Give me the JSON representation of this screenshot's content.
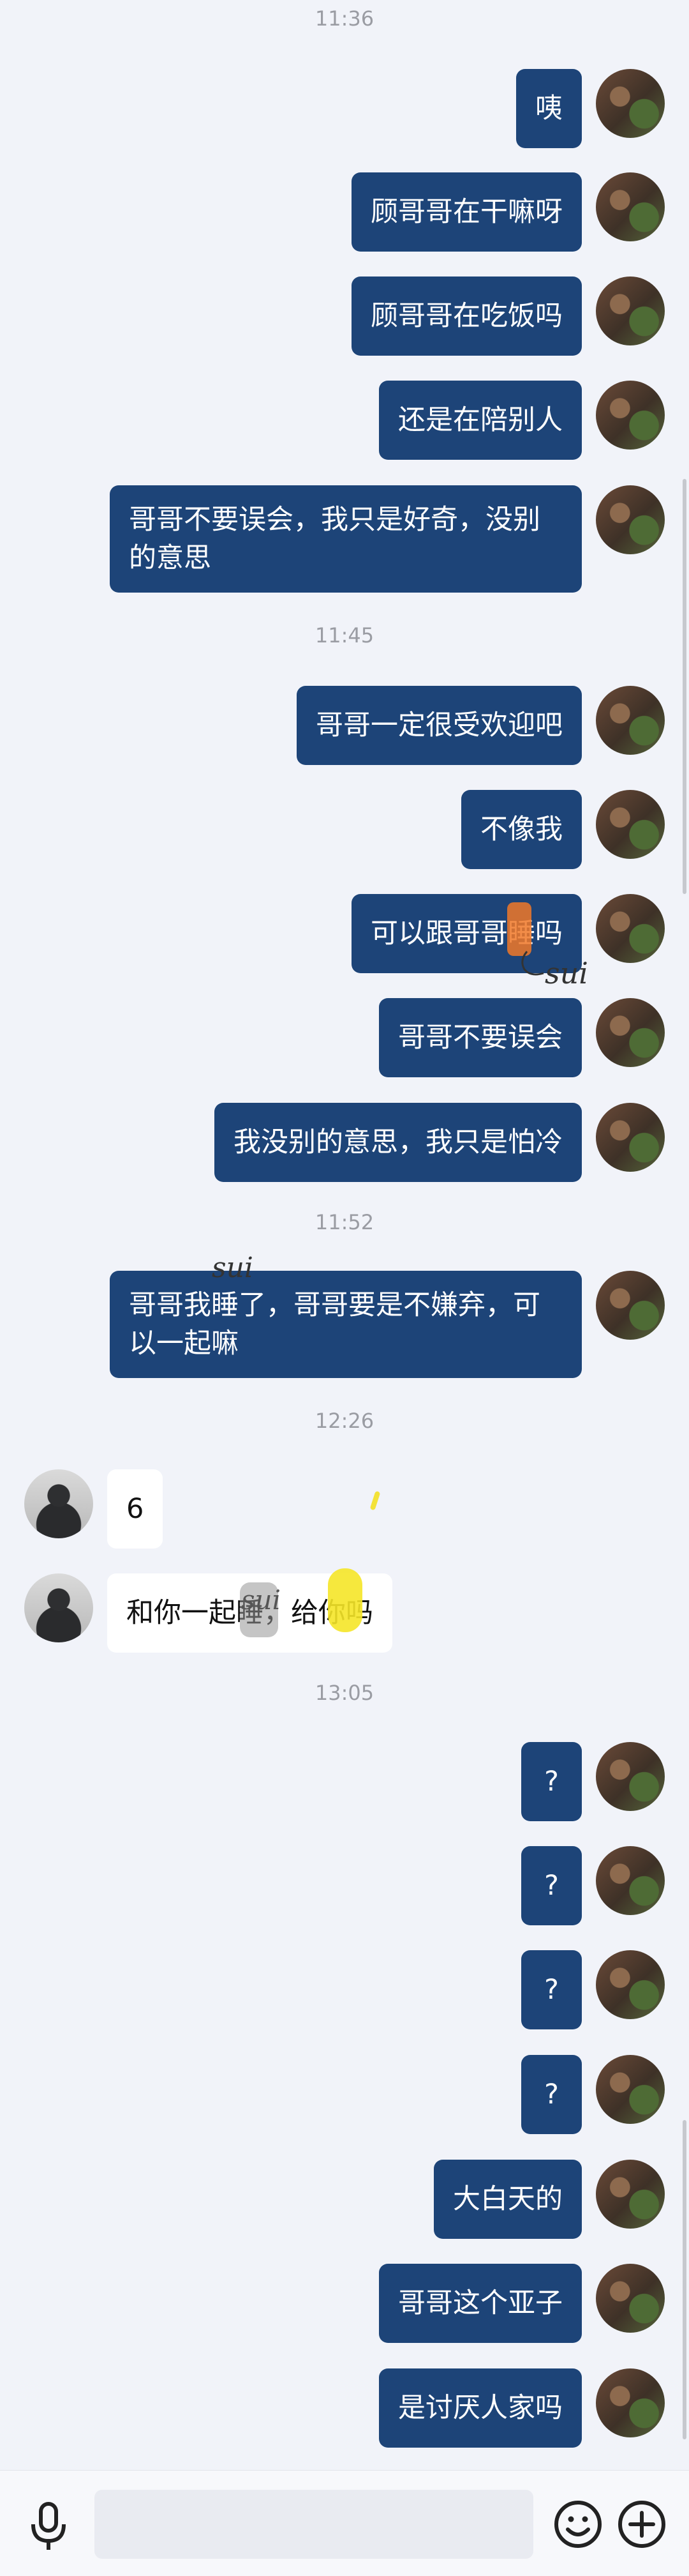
{
  "messages": [
    {
      "type": "timestamp",
      "text": "11:36"
    },
    {
      "type": "out",
      "text": "咦"
    },
    {
      "type": "out",
      "text": "顾哥哥在干嘛呀"
    },
    {
      "type": "out",
      "text": "顾哥哥在吃饭吗"
    },
    {
      "type": "out",
      "text": "还是在陪别人"
    },
    {
      "type": "out",
      "text": "哥哥不要误会，我只是好奇，没别的意思"
    },
    {
      "type": "timestamp",
      "text": "11:45"
    },
    {
      "type": "out",
      "text": "哥哥一定很受欢迎吧"
    },
    {
      "type": "out",
      "text": "不像我"
    },
    {
      "type": "out",
      "text": "可以跟哥哥睡吗"
    },
    {
      "type": "out",
      "text": "哥哥不要误会"
    },
    {
      "type": "out",
      "text": "我没别的意思，我只是怕冷"
    },
    {
      "type": "timestamp",
      "text": "11:52"
    },
    {
      "type": "out",
      "text": "哥哥我睡了，哥哥要是不嫌弃，可以一起嘛"
    },
    {
      "type": "timestamp",
      "text": "12:26"
    },
    {
      "type": "in",
      "text": "6"
    },
    {
      "type": "in",
      "text": "和你一起睡，给你吗"
    },
    {
      "type": "timestamp",
      "text": "13:05"
    },
    {
      "type": "out",
      "text": "?"
    },
    {
      "type": "out",
      "text": "?"
    },
    {
      "type": "out",
      "text": "?"
    },
    {
      "type": "out",
      "text": "?"
    },
    {
      "type": "out",
      "text": "大白天的"
    },
    {
      "type": "out",
      "text": "哥哥这个亚子"
    },
    {
      "type": "out",
      "text": "是讨厌人家吗"
    }
  ],
  "annotations": {
    "sui_1": "sui",
    "sui_2": "sui",
    "sui_3": "sui"
  },
  "input": {
    "value": "",
    "placeholder": ""
  },
  "icons": {
    "voice": "microphone-icon",
    "emoji": "smiley-icon",
    "add": "plus-circle-icon"
  },
  "colors": {
    "background": "#f1f3f9",
    "outgoing_bubble": "#1d4478",
    "incoming_bubble": "#ffffff",
    "timestamp": "#9a9ca3"
  }
}
